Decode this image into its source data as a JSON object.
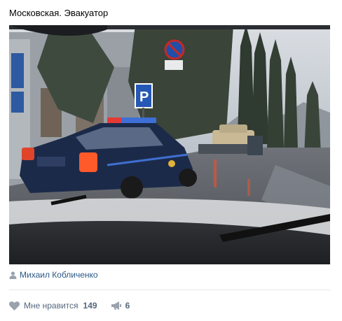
{
  "post": {
    "title": "Московская. Эвакуатор"
  },
  "photo": {
    "alt_sign_text": "Р"
  },
  "author": {
    "name": "Михаил Кобличенко"
  },
  "actions": {
    "like_label": "Мне нравится",
    "like_count": "149",
    "share_count": "6"
  },
  "colors": {
    "link": "#2a5885",
    "muted": "#55677d",
    "icon": "#99a2ad",
    "divider": "#e7e8ec"
  }
}
